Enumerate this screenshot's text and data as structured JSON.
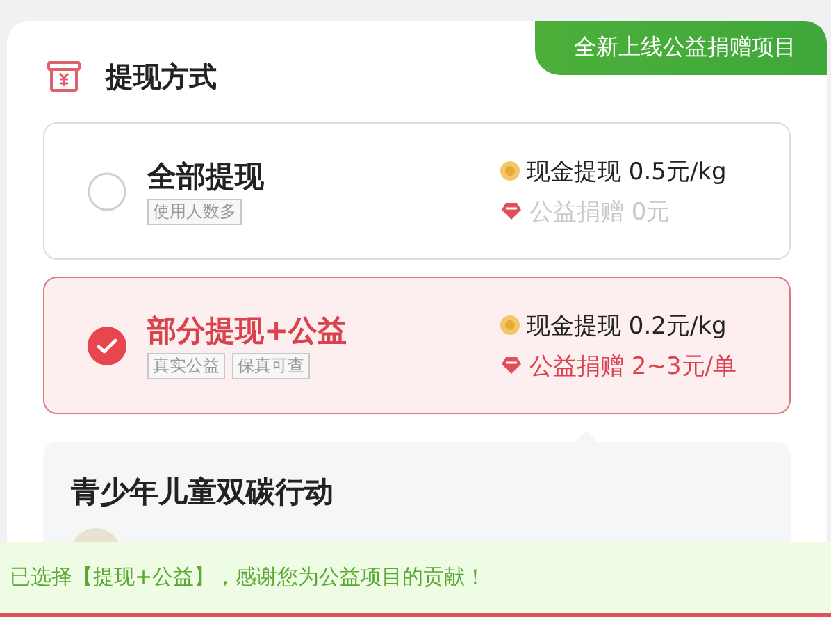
{
  "banner": "全新上线公益捐赠项目",
  "section": {
    "title": "提现方式"
  },
  "options": [
    {
      "title": "全部提现",
      "tags": [
        "使用人数多"
      ],
      "cash": "现金提现 0.5元/kg",
      "donation": "公益捐赠 0元",
      "selected": false
    },
    {
      "title": "部分提现+公益",
      "tags": [
        "真实公益",
        "保真可查"
      ],
      "cash": "现金提现 0.2元/kg",
      "donation": "公益捐赠 2~3元/单",
      "selected": true
    }
  ],
  "project": {
    "title": "青少年儿童双碳行动"
  },
  "toast": "已选择【提现+公益】，感谢您为公益项目的贡献！"
}
